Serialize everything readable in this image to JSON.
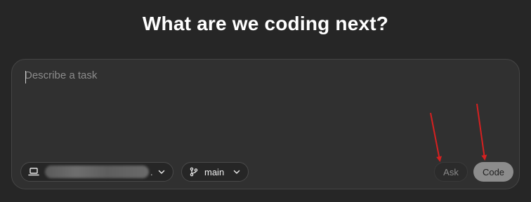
{
  "header": {
    "title": "What are we coding next?"
  },
  "composer": {
    "placeholder": "Describe a task",
    "value": ""
  },
  "environment_selector": {
    "icon": "laptop-icon",
    "label_suffix": "."
  },
  "branch_selector": {
    "icon": "git-branch-icon",
    "label": "main"
  },
  "actions": {
    "ask_label": "Ask",
    "code_label": "Code"
  },
  "colors": {
    "background": "#262626",
    "composer": "#303030",
    "annotation_arrow": "#d62020"
  }
}
